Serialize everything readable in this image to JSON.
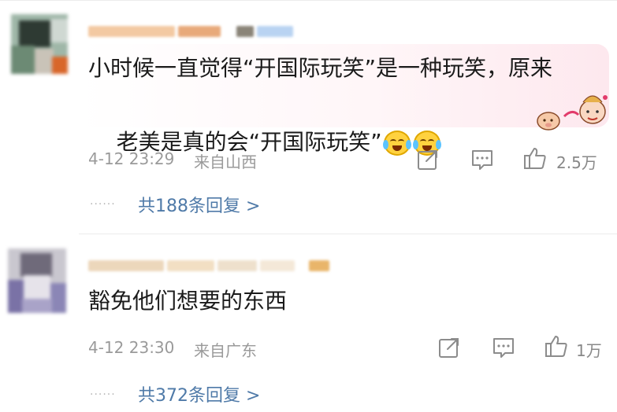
{
  "comments": [
    {
      "text_lines": [
        "小时候一直觉得“开国际玩笑”是一种玩笑，原来",
        "老美是真的会“开国际玩笑”"
      ],
      "emojis": [
        "crying-laughing-emoji",
        "crying-laughing-emoji"
      ],
      "date": "4-12 23:29",
      "location": "来自山西",
      "likes": "2.5万",
      "replies": "共188条回复 >",
      "reply_dots": "······"
    },
    {
      "text_lines": [
        "豁免他们想要的东西"
      ],
      "date": "4-12 23:30",
      "location": "来自广东",
      "likes": "1万",
      "replies": "共372条回复 >",
      "reply_dots": "······"
    }
  ],
  "colors": {
    "reply_link": "#4f7aa8",
    "meta_text": "#9a9a9a",
    "bubble_accent": "#fde8ee"
  },
  "icons": [
    "share-icon",
    "comment-icon",
    "like-icon"
  ]
}
